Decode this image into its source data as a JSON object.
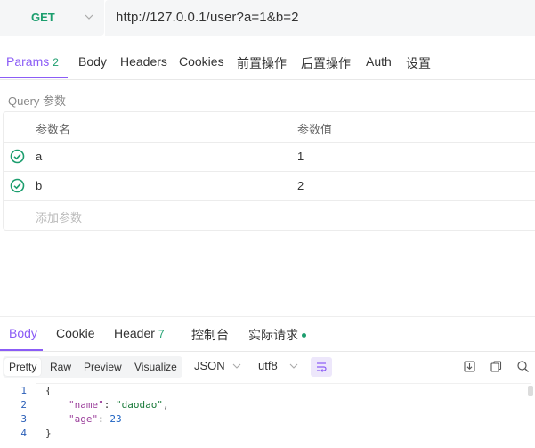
{
  "request": {
    "method": "GET",
    "url": "http://127.0.0.1/user?a=1&b=2"
  },
  "request_tabs": [
    {
      "label": "Params",
      "count": "2",
      "active": true
    },
    {
      "label": "Body"
    },
    {
      "label": "Headers"
    },
    {
      "label": "Cookies"
    },
    {
      "label": "前置操作"
    },
    {
      "label": "后置操作"
    },
    {
      "label": "Auth"
    },
    {
      "label": "设置"
    }
  ],
  "query": {
    "section_label": "Query 参数",
    "columns": {
      "name": "参数名",
      "value": "参数值"
    },
    "rows": [
      {
        "name": "a",
        "value": "1",
        "enabled": true
      },
      {
        "name": "b",
        "value": "2",
        "enabled": true
      }
    ],
    "add_placeholder": "添加参数"
  },
  "response_tabs": [
    {
      "label": "Body",
      "active": true
    },
    {
      "label": "Cookie"
    },
    {
      "label": "Header",
      "count": "7"
    },
    {
      "label": "控制台"
    },
    {
      "label": "实际请求",
      "dot": true
    }
  ],
  "response_toolbar": {
    "formats": [
      "Pretty",
      "Raw",
      "Preview",
      "Visualize"
    ],
    "active_format": "Pretty",
    "language": "JSON",
    "encoding": "utf8"
  },
  "response_body": {
    "line_numbers": [
      "1",
      "2",
      "3",
      "4"
    ],
    "open_brace": "{",
    "close_brace": "}",
    "fields": [
      {
        "key": "\"name\"",
        "value": "\"daodao\"",
        "type": "string",
        "trail": ","
      },
      {
        "key": "\"age\"",
        "value": "23",
        "type": "number",
        "trail": ""
      }
    ]
  },
  "colors": {
    "accent": "#8b5cf6",
    "method_green": "#1c9e6e",
    "check_green": "#1c9e6e"
  }
}
